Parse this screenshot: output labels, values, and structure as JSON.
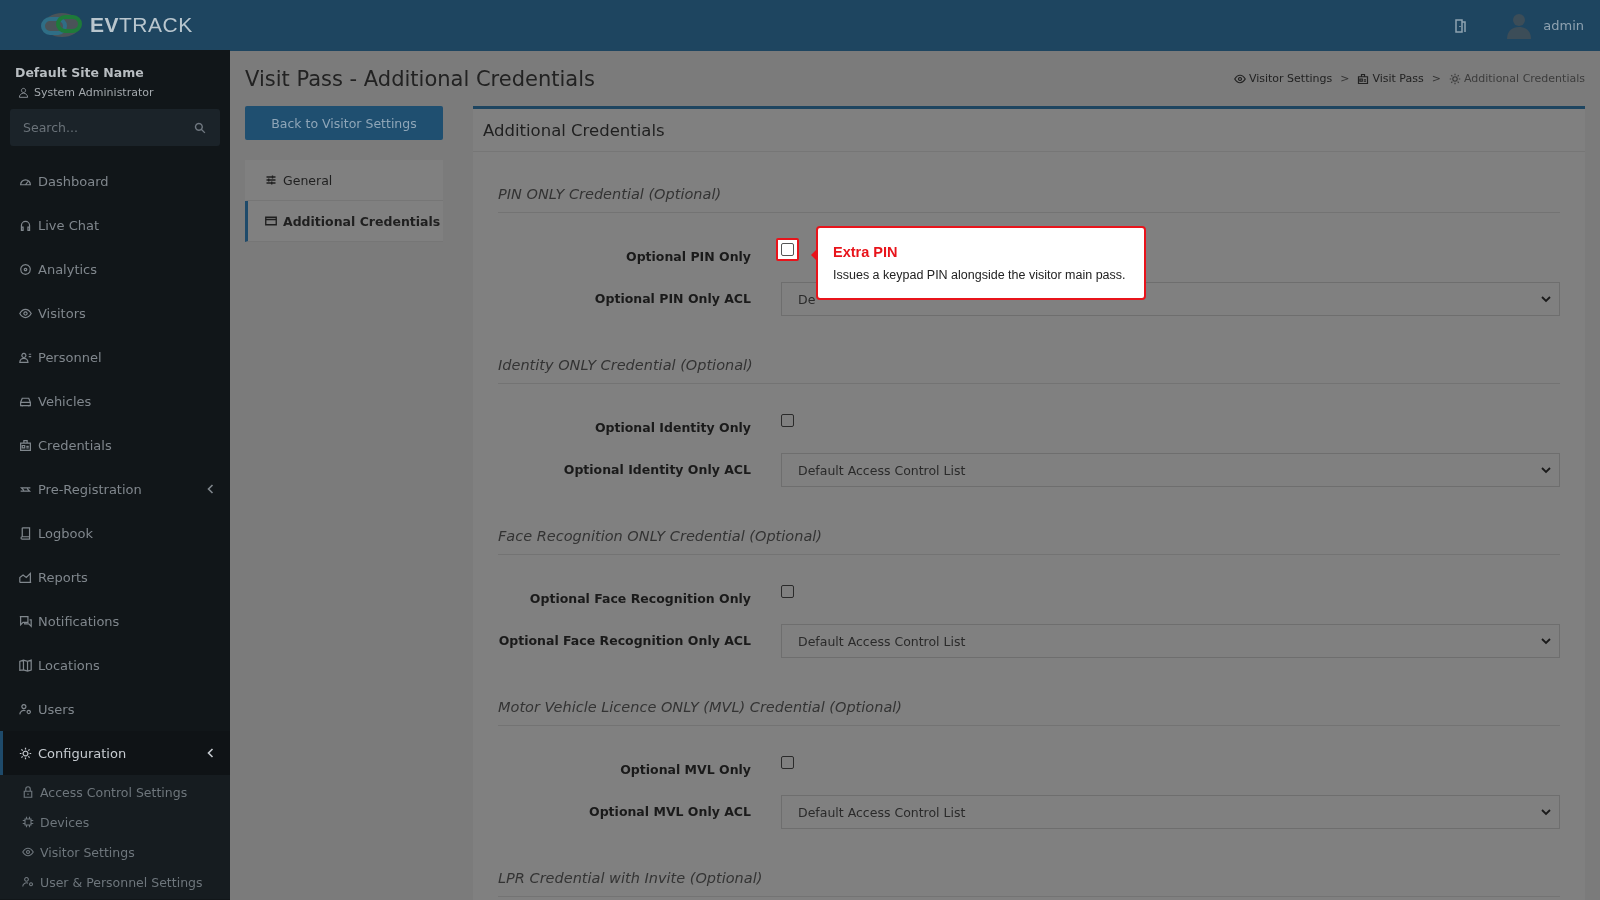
{
  "brand": {
    "name": "**EV**TRACK"
  },
  "topbar": {
    "user": "admin"
  },
  "sidebar": {
    "site": "Default Site Name",
    "role": "System Administrator",
    "search": {
      "placeholder": "Search..."
    },
    "items": [
      {
        "label": "Dashboard",
        "selected": false,
        "has_submenu": false
      },
      {
        "label": "Live Chat",
        "selected": false,
        "has_submenu": false
      },
      {
        "label": "Analytics",
        "selected": false,
        "has_submenu": false
      },
      {
        "label": "Visitors",
        "selected": false,
        "has_submenu": false
      },
      {
        "label": "Personnel",
        "selected": false,
        "has_submenu": false
      },
      {
        "label": "Vehicles",
        "selected": false,
        "has_submenu": false
      },
      {
        "label": "Credentials",
        "selected": false,
        "has_submenu": false
      },
      {
        "label": "Pre-Registration",
        "selected": false,
        "has_submenu": true
      },
      {
        "label": "Logbook",
        "selected": false,
        "has_submenu": false
      },
      {
        "label": "Reports",
        "selected": false,
        "has_submenu": false
      },
      {
        "label": "Notifications",
        "selected": false,
        "has_submenu": false
      },
      {
        "label": "Locations",
        "selected": false,
        "has_submenu": false
      },
      {
        "label": "Users",
        "selected": false,
        "has_submenu": false
      },
      {
        "label": "Configuration",
        "selected": true,
        "has_submenu": true,
        "children": [
          {
            "label": "Access Control Settings",
            "selected": false
          },
          {
            "label": "Devices",
            "selected": false
          },
          {
            "label": "Visitor Settings",
            "selected": false
          },
          {
            "label": "User & Personnel Settings",
            "selected": false
          }
        ]
      }
    ]
  },
  "page": {
    "title": "Visit Pass - Additional Credentials",
    "breadcrumbs": [
      {
        "label": "Visitor Settings",
        "current": false
      },
      {
        "label": "Visit Pass",
        "current": false
      },
      {
        "label": "Additional Credentials",
        "current": true
      }
    ],
    "breadcrumb_separator": ">",
    "back_button": "Back to Visitor Settings",
    "tabs": [
      {
        "label": "General",
        "selected": false
      },
      {
        "label": "Additional Credentials",
        "selected": true
      }
    ],
    "card": {
      "title": "Additional Credentials",
      "sections": [
        {
          "title": "PIN ONLY Credential (Optional)",
          "fields": [
            {
              "label": "Optional PIN Only",
              "kind": "checkbox",
              "checked": false,
              "highlighted": true
            },
            {
              "label": "Optional PIN Only ACL",
              "kind": "select",
              "value": "De"
            }
          ]
        },
        {
          "title": "Identity ONLY Credential (Optional)",
          "fields": [
            {
              "label": "Optional Identity Only",
              "kind": "checkbox",
              "checked": false,
              "highlighted": false
            },
            {
              "label": "Optional Identity Only ACL",
              "kind": "select",
              "value": "Default Access Control List"
            }
          ]
        },
        {
          "title": "Face Recognition ONLY Credential (Optional)",
          "fields": [
            {
              "label": "Optional Face Recognition Only",
              "kind": "checkbox",
              "checked": false,
              "highlighted": false
            },
            {
              "label": "Optional Face Recognition Only ACL",
              "kind": "select",
              "value": "Default Access Control List"
            }
          ]
        },
        {
          "title": "Motor Vehicle Licence ONLY (MVL) Credential (Optional)",
          "fields": [
            {
              "label": "Optional MVL Only",
              "kind": "checkbox",
              "checked": false,
              "highlighted": false
            },
            {
              "label": "Optional MVL Only ACL",
              "kind": "select",
              "value": "Default Access Control List"
            }
          ]
        },
        {
          "title": "LPR Credential with Invite (Optional)"
        }
      ]
    }
  },
  "tour": {
    "title": "Extra PIN",
    "text": "Issues a keypad PIN alongside the visitor main pass."
  }
}
